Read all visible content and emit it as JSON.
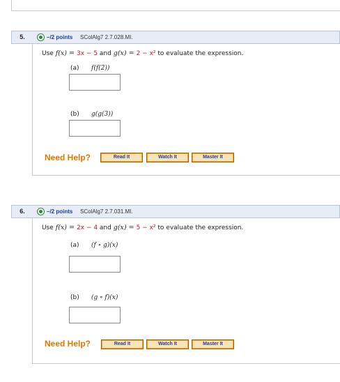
{
  "questions": [
    {
      "number": "5.",
      "points": "–/2 points",
      "ref": "SColAlg7 2.7.028.MI.",
      "prompt": {
        "use": "Use",
        "f_def": "f(x) = ",
        "f_expr": "3x − 5",
        "and": "and",
        "g_def": "g(x) = ",
        "g_expr": "2 − x²",
        "tail": "to evaluate the expression."
      },
      "parts": [
        {
          "label": "(a)",
          "expr": "f(f(2))",
          "answer": ""
        },
        {
          "label": "(b)",
          "expr": "g(g(3))",
          "answer": ""
        }
      ],
      "help": {
        "label": "Need Help?",
        "buttons": [
          "Read It",
          "Watch It",
          "Master It"
        ]
      }
    },
    {
      "number": "6.",
      "points": "–/2 points",
      "ref": "SColAlg7 2.7.031.MI.",
      "prompt": {
        "use": "Use",
        "f_def": "f(x) = ",
        "f_expr": "2x − 4",
        "and": "and",
        "g_def": "g(x) = ",
        "g_expr": "5 − x²",
        "tail": "to evaluate the expression."
      },
      "parts": [
        {
          "label": "(a)",
          "expr": "(f ∘ g)(x)",
          "answer": ""
        },
        {
          "label": "(b)",
          "expr": "(g ∘ f)(x)",
          "answer": ""
        }
      ],
      "help": {
        "label": "Need Help?",
        "buttons": [
          "Read It",
          "Watch It",
          "Master It"
        ]
      }
    }
  ],
  "colors": {
    "points": "#1d3f9c",
    "function": "#c0171c",
    "help": "#e07800",
    "button": "#f5a623"
  }
}
